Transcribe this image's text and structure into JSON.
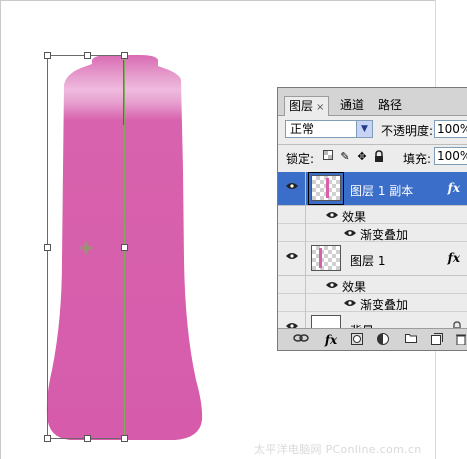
{
  "canvas": {
    "background": "#ffffff",
    "shape_color": "#d65cab",
    "highlight_color": "#efb9de"
  },
  "layers_panel": {
    "tabs": [
      {
        "label": "图层",
        "active": true,
        "close": "×"
      },
      {
        "label": "通道",
        "active": false
      },
      {
        "label": "路径",
        "active": false
      }
    ],
    "blend_mode": "正常",
    "opacity_label": "不透明度:",
    "opacity_value": "100%",
    "lock_label": "锁定:",
    "fill_label": "填充:",
    "fill_value": "100%",
    "layers": [
      {
        "name": "图层 1 副本",
        "selected": true,
        "fx": "fx",
        "effects_label": "效果",
        "effects": [
          "渐变叠加"
        ]
      },
      {
        "name": "图层 1",
        "selected": false,
        "fx": "fx",
        "effects_label": "效果",
        "effects": [
          "渐变叠加"
        ]
      },
      {
        "name": "背景",
        "selected": false
      }
    ],
    "bottom_icons": [
      "link-icon",
      "fx-icon",
      "mask-icon",
      "adjustment-icon",
      "folder-icon",
      "new-layer-icon",
      "trash-icon"
    ],
    "bottom_fx_label": "fx"
  },
  "watermark": "太平洋电脑网 PConline.com.cn",
  "colors": {
    "selection": "#3a6ec8",
    "panel_bg": "#ececec",
    "guide": "#7faa5c"
  }
}
